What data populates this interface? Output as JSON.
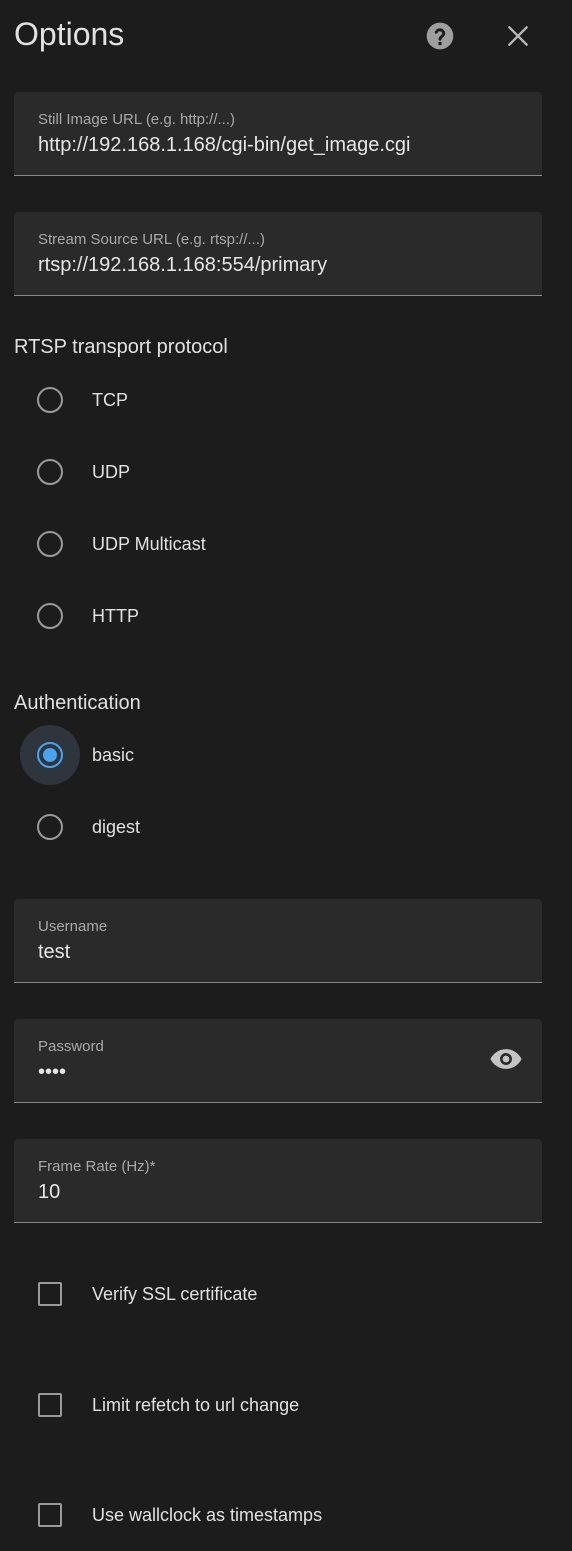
{
  "header": {
    "title": "Options",
    "help_icon": "help-circle-icon",
    "close_icon": "close-icon"
  },
  "fields": {
    "still_image_url": {
      "label": "Still Image URL (e.g. http://...)",
      "value": "http://192.168.1.168/cgi-bin/get_image.cgi"
    },
    "stream_source_url": {
      "label": "Stream Source URL (e.g. rtsp://...)",
      "value": "rtsp://192.168.1.168:554/primary"
    },
    "username": {
      "label": "Username",
      "value": "test"
    },
    "password": {
      "label": "Password",
      "value": "••••",
      "toggle_icon": "eye-icon"
    },
    "frame_rate": {
      "label": "Frame Rate (Hz)*",
      "value": "10"
    }
  },
  "rtsp_transport": {
    "title": "RTSP transport protocol",
    "options": [
      {
        "label": "TCP",
        "checked": false
      },
      {
        "label": "UDP",
        "checked": false
      },
      {
        "label": "UDP Multicast",
        "checked": false
      },
      {
        "label": "HTTP",
        "checked": false
      }
    ]
  },
  "authentication": {
    "title": "Authentication",
    "options": [
      {
        "label": "basic",
        "checked": true
      },
      {
        "label": "digest",
        "checked": false
      }
    ]
  },
  "checkboxes": [
    {
      "label": "Verify SSL certificate",
      "checked": false
    },
    {
      "label": "Limit refetch to url change",
      "checked": false
    },
    {
      "label": "Use wallclock as timestamps",
      "checked": false
    }
  ],
  "colors": {
    "background": "#1c1c1c",
    "field_background": "#2a2a2a",
    "accent": "#4aa3f0",
    "text": "#e1e1e1",
    "muted_text": "#a9a9a9"
  }
}
